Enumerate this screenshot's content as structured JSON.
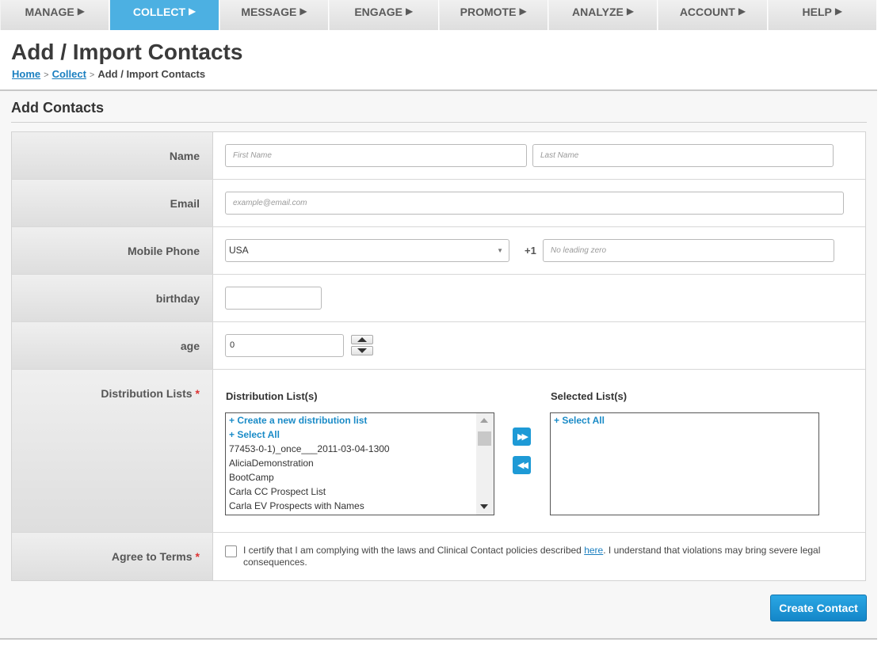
{
  "nav": {
    "items": [
      {
        "label": "MANAGE",
        "arrow": "▶"
      },
      {
        "label": "COLLECT",
        "arrow": "▶"
      },
      {
        "label": "MESSAGE",
        "arrow": "▶"
      },
      {
        "label": "ENGAGE",
        "arrow": "▶"
      },
      {
        "label": "PROMOTE",
        "arrow": "▶"
      },
      {
        "label": "ANALYZE",
        "arrow": "▶"
      },
      {
        "label": "ACCOUNT",
        "arrow": "▶"
      },
      {
        "label": "HELP",
        "arrow": "▶"
      }
    ],
    "active": "COLLECT",
    "active_color": "#4cb0e2"
  },
  "page": {
    "title": "Add / Import Contacts",
    "breadcrumb": {
      "home": "Home",
      "collect": "Collect",
      "current": "Add / Import Contacts",
      "sep": ">"
    }
  },
  "form": {
    "section_title": "Add Contacts",
    "name": {
      "label": "Name",
      "first_placeholder": "First Name",
      "last_placeholder": "Last Name"
    },
    "email": {
      "label": "Email",
      "placeholder": "example@email.com"
    },
    "mobile": {
      "label": "Mobile Phone",
      "country": "USA",
      "code": "+1",
      "placeholder": "No leading zero"
    },
    "birthday": {
      "label": "birthday",
      "value": ""
    },
    "age": {
      "label": "age",
      "value": "0"
    },
    "distribution": {
      "label": "Distribution Lists",
      "required_mark": "*",
      "available_header": "Distribution List(s)",
      "selected_header": "Selected List(s)",
      "available_items": [
        {
          "text": "+ Create a new distribution list",
          "link": true
        },
        {
          "text": "+ Select All",
          "link": true
        },
        {
          "text": "77453-0-1)_once___2011-03-04-1300",
          "link": false
        },
        {
          "text": "AliciaDemonstration",
          "link": false
        },
        {
          "text": "BootCamp",
          "link": false
        },
        {
          "text": "Carla CC Prospect List",
          "link": false
        },
        {
          "text": "Carla EV Prospects with Names",
          "link": false
        }
      ],
      "selected_items": [
        {
          "text": "+ Select All",
          "link": true
        }
      ],
      "add_symbol": "▶▶",
      "remove_symbol": "◀◀"
    },
    "terms": {
      "label": "Agree to Terms",
      "required_mark": "*",
      "text_before": "I certify that I am complying with the laws and Clinical Contact policies described ",
      "link_text": "here",
      "text_after": ". I understand that violations may bring severe legal consequences.",
      "checked": false
    },
    "submit_label": "Create Contact"
  }
}
